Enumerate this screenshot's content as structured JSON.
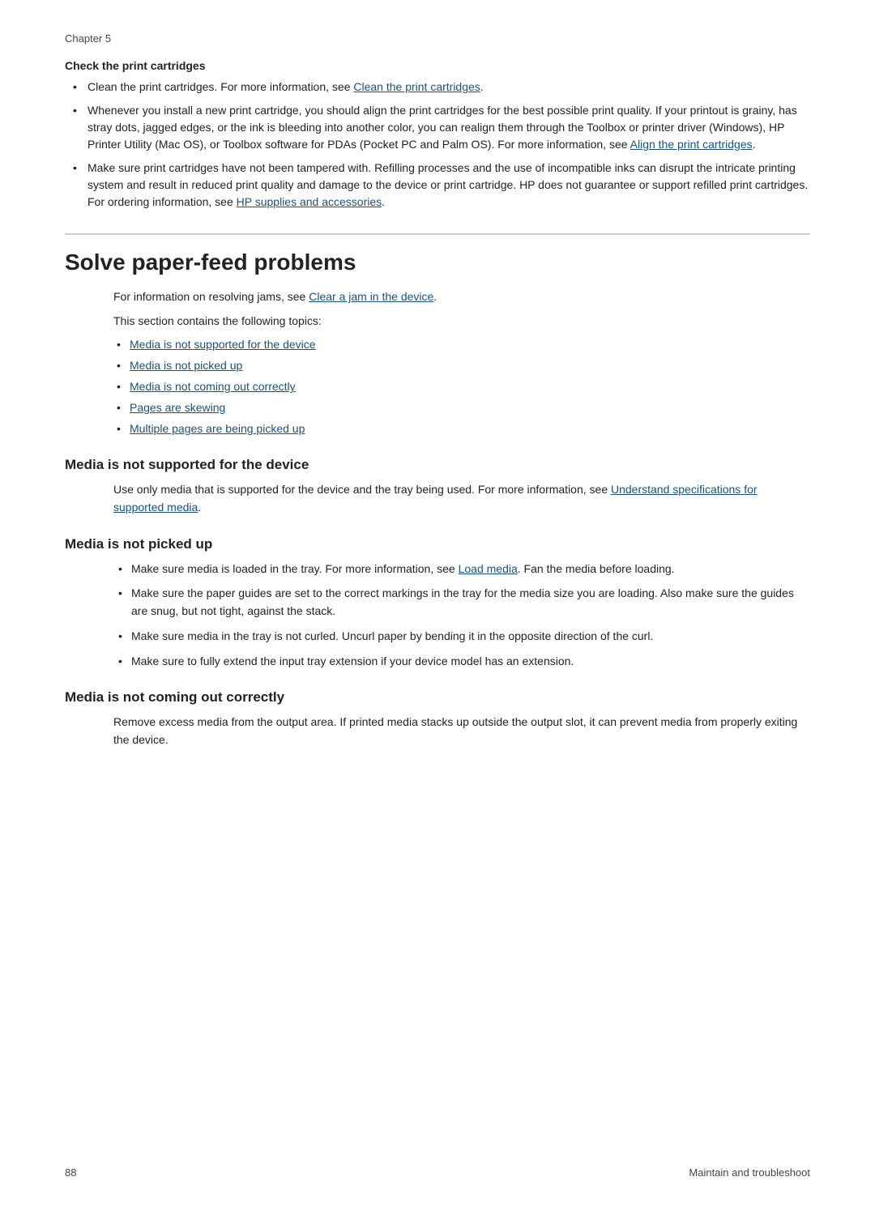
{
  "chapter": {
    "label": "Chapter 5"
  },
  "check_cartridges": {
    "title": "Check the print cartridges",
    "bullet1": "Clean the print cartridges. For more information, see ",
    "bullet1_link": "Clean the print cartridges",
    "bullet2": "Whenever you install a new print cartridge, you should align the print cartridges for the best possible print quality. If your printout is grainy, has stray dots, jagged edges, or the ink is bleeding into another color, you can realign them through the Toolbox or printer driver (Windows), HP Printer Utility (Mac OS), or Toolbox software for PDAs (Pocket PC and Palm OS). For more information, see ",
    "bullet2_link": "Align the print cartridges",
    "bullet3_before": "Make sure print cartridges have not been tampered with. Refilling processes and the use of incompatible inks can disrupt the intricate printing system and result in reduced print quality and damage to the device or print cartridge. HP does not guarantee or support refilled print cartridges. For ordering information, see ",
    "bullet3_link": "HP supplies and accessories",
    "bullet3_after": "."
  },
  "main_section": {
    "heading": "Solve paper-feed problems",
    "intro_before": "For information on resolving jams, see ",
    "intro_link": "Clear a jam in the device",
    "intro_after": ".",
    "topics_intro": "This section contains the following topics:",
    "topics": [
      {
        "label": "Media is not supported for the device"
      },
      {
        "label": "Media is not picked up"
      },
      {
        "label": "Media is not coming out correctly"
      },
      {
        "label": "Pages are skewing"
      },
      {
        "label": "Multiple pages are being picked up"
      }
    ]
  },
  "media_not_supported": {
    "heading": "Media is not supported for the device",
    "body_before": "Use only media that is supported for the device and the tray being used. For more information, see ",
    "body_link": "Understand specifications for supported media",
    "body_after": "."
  },
  "media_not_picked_up": {
    "heading": "Media is not picked up",
    "bullets": [
      {
        "before": "Make sure media is loaded in the tray. For more information, see ",
        "link": "Load media",
        "after": ". Fan the media before loading."
      },
      {
        "text": "Make sure the paper guides are set to the correct markings in the tray for the media size you are loading. Also make sure the guides are snug, but not tight, against the stack."
      },
      {
        "text": "Make sure media in the tray is not curled. Uncurl paper by bending it in the opposite direction of the curl."
      },
      {
        "text": "Make sure to fully extend the input tray extension if your device model has an extension."
      }
    ]
  },
  "media_not_coming_out": {
    "heading": "Media is not coming out correctly",
    "body": "Remove excess media from the output area. If printed media stacks up outside the output slot, it can prevent media from properly exiting the device."
  },
  "footer": {
    "page_number": "88",
    "section_label": "Maintain and troubleshoot"
  }
}
